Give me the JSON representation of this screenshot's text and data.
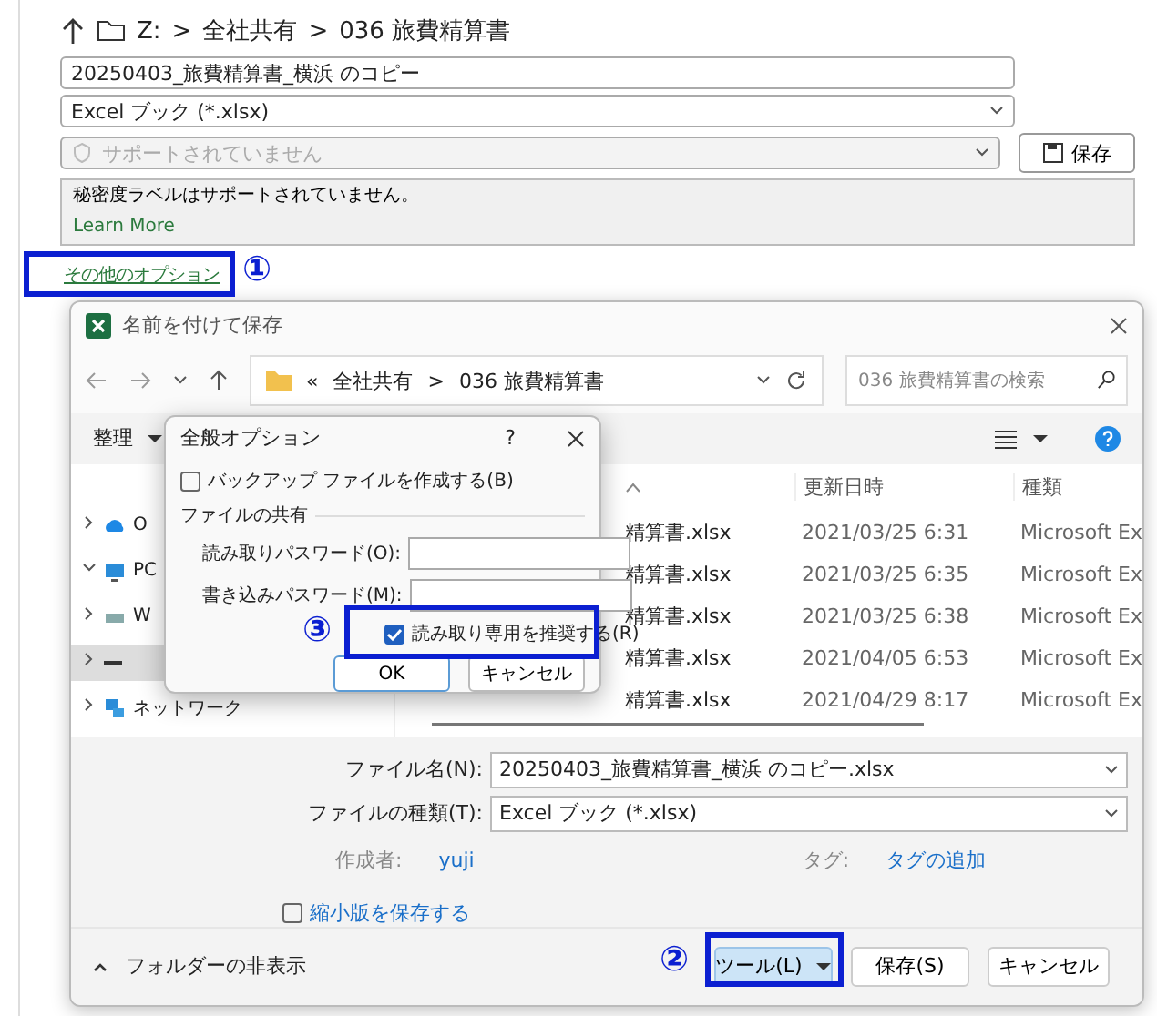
{
  "backstage": {
    "path": [
      "Z:",
      ">",
      "全社共有",
      ">",
      "036 旅費精算書"
    ],
    "file_name": {
      "value": "20250403_旅費精算書_横浜 のコピー"
    },
    "file_type": {
      "value": "Excel ブック (*.xlsx)"
    },
    "sensitivity": {
      "value": "サポートされていません",
      "disabled": true
    },
    "save_button": "保存",
    "notice": {
      "text": "秘密度ラベルはサポートされていません。",
      "link": "Learn More"
    },
    "more_options_link": "その他のオプション"
  },
  "save_as_dialog": {
    "title": "名前を付けて保存",
    "address": [
      "«",
      "全社共有",
      ">",
      "036 旅費精算書"
    ],
    "search": {
      "placeholder": "036 旅費精算書の検索"
    },
    "organize": "整理",
    "nav_items": [
      {
        "label": "O",
        "expanded": false,
        "kind": "cloud"
      },
      {
        "label": "PC",
        "expanded": true,
        "kind": "pc"
      },
      {
        "label": "W",
        "expanded": false,
        "kind": "drive"
      },
      {
        "expanded": false,
        "kind": "disk",
        "selected": true
      },
      {
        "label": "ネットワーク",
        "expanded": false,
        "kind": "network"
      }
    ],
    "columns": [
      "更新日時",
      "種類"
    ],
    "rows": [
      {
        "name": "精算書.xlsx",
        "date": "2021/03/25 6:31",
        "type": "Microsoft Ex"
      },
      {
        "name": "精算書.xlsx",
        "date": "2021/03/25 6:35",
        "type": "Microsoft Ex"
      },
      {
        "name": "精算書.xlsx",
        "date": "2021/03/25 6:38",
        "type": "Microsoft Ex"
      },
      {
        "name": "精算書.xlsx",
        "date": "2021/04/05 6:53",
        "type": "Microsoft Ex"
      },
      {
        "name": "精算書.xlsx",
        "date": "2021/04/29 8:17",
        "type": "Microsoft Ex"
      }
    ],
    "file_name_label": "ファイル名(N):",
    "file_name": "20250403_旅費精算書_横浜 のコピー.xlsx",
    "file_type_label": "ファイルの種類(T):",
    "file_type": "Excel ブック (*.xlsx)",
    "author_label": "作成者:",
    "author": "yuji",
    "tags_label": "タグ:",
    "tags": "タグの追加",
    "thumbnail": {
      "label": "縮小版を保存する",
      "checked": false
    },
    "hide_folders": "フォルダーの非表示",
    "buttons": [
      {
        "label": "ツール(L)",
        "kind": "menu"
      },
      {
        "label": "保存(S)",
        "kind": "plain"
      },
      {
        "label": "キャンセル",
        "kind": "plain"
      }
    ]
  },
  "general_options": {
    "title": "全般オプション",
    "help": "?",
    "backup": {
      "label": "バックアップ ファイルを作成する(B)",
      "checked": false
    },
    "group": "ファイルの共有",
    "fields": [
      {
        "label": "読み取りパスワード(O):"
      },
      {
        "label": "書き込みパスワード(M):"
      }
    ],
    "read_only": {
      "label": "読み取り専用を推奨する(R)",
      "checked": true
    },
    "buttons": [
      "OK",
      "キャンセル"
    ]
  },
  "annotations": [
    "①",
    "②",
    "③"
  ]
}
